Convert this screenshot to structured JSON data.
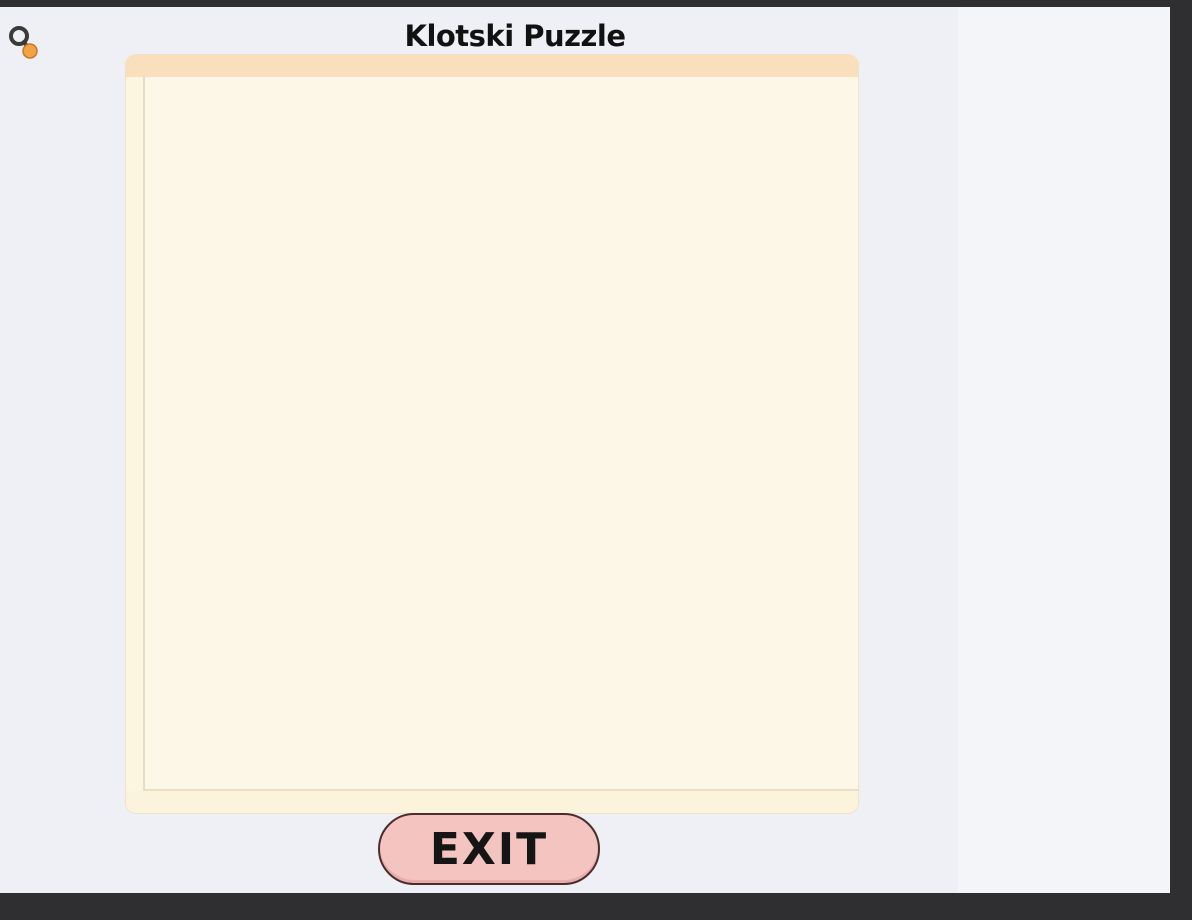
{
  "window": {
    "title": "Klotski Puzzle"
  },
  "icons": {
    "app_icon": "search-magnifier-icon"
  },
  "controls": {
    "exit_label": "EXIT"
  },
  "colors": {
    "board_header": "#f9dfbb",
    "board_surface": "#fdf7e7",
    "exit_button_fill": "#f4c4c1",
    "exit_button_border": "#4b2d2d",
    "background": "#eef0f5"
  }
}
